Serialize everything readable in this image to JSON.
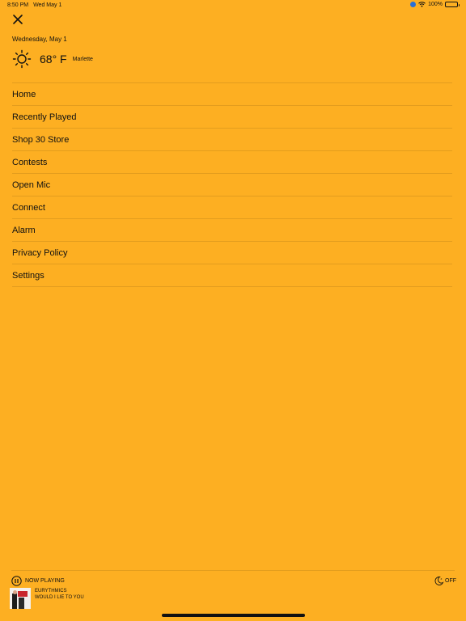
{
  "status_bar": {
    "time": "8:50 PM",
    "date": "Wed May 1",
    "battery": "100%"
  },
  "header": {
    "date": "Wednesday, May 1",
    "temperature": "68° F",
    "city": "Marlette"
  },
  "menu": {
    "items": [
      {
        "label": "Home"
      },
      {
        "label": "Recently Played"
      },
      {
        "label": "Shop 30 Store"
      },
      {
        "label": "Contests"
      },
      {
        "label": "Open Mic"
      },
      {
        "label": "Connect"
      },
      {
        "label": "Alarm"
      },
      {
        "label": "Privacy Policy"
      },
      {
        "label": "Settings"
      }
    ]
  },
  "player": {
    "now_playing_label": "NOW PLAYING",
    "artist": "EURYTHMICS",
    "track": "WOULD I LIE TO YOU",
    "sleep_timer": "OFF"
  },
  "colors": {
    "background": "#FDAF22",
    "text": "#111111"
  },
  "icons": {
    "close": "close-icon",
    "weather": "sun-icon",
    "pause": "pause-icon",
    "sleep": "moon-icon"
  }
}
